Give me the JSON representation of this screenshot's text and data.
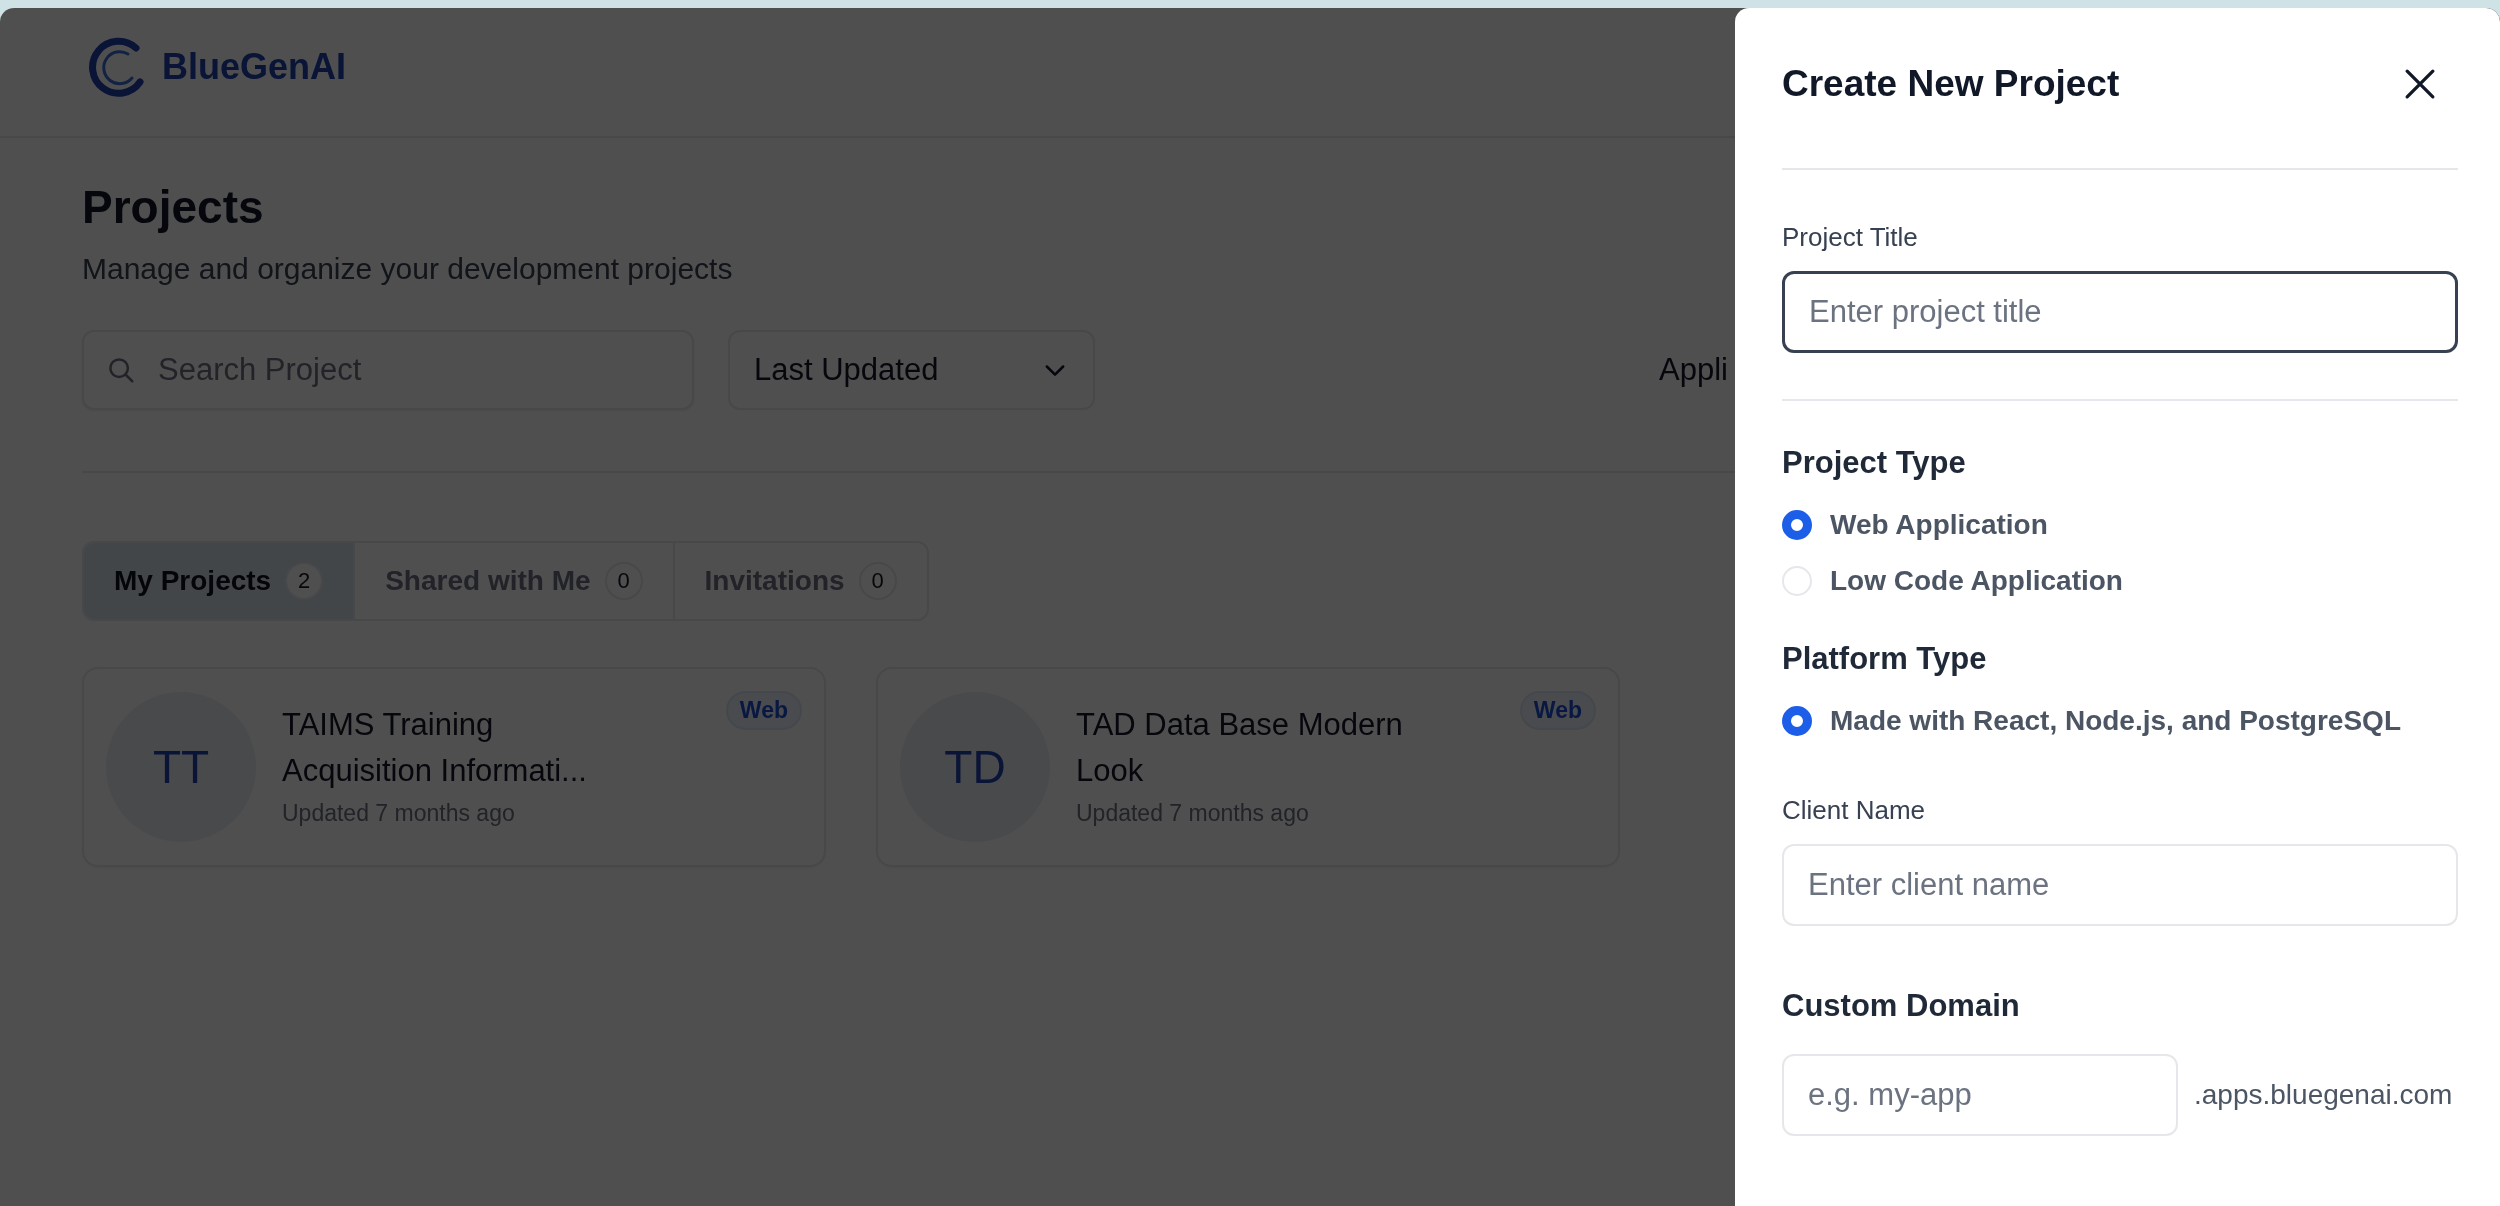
{
  "app": {
    "logo_text": "BlueGenAI"
  },
  "page": {
    "title": "Projects",
    "subtitle": "Manage and organize your development projects",
    "search": {
      "placeholder": "Search Project"
    },
    "sort": {
      "value": "Last Updated"
    },
    "cut_button": {
      "label": "Appli"
    }
  },
  "tabs": [
    {
      "label": "My Projects",
      "count": "2",
      "selected": true
    },
    {
      "label": "Shared with Me",
      "count": "0",
      "selected": false
    },
    {
      "label": "Invitations",
      "count": "0",
      "selected": false
    }
  ],
  "projects": [
    {
      "initials": "TT",
      "title": "TAIMS Training Acquisition Informati...",
      "updated": "Updated 7 months ago",
      "badge": "Web"
    },
    {
      "initials": "TD",
      "title": "TAD Data Base Modern Look",
      "updated": "Updated 7 months ago",
      "badge": "Web"
    }
  ],
  "dialog": {
    "title": "Create New Project",
    "fields": [
      {
        "kind": "text",
        "label": "Project Title",
        "placeholder": "Enter project title",
        "focused": true,
        "divider_after": true
      },
      {
        "kind": "radio_group",
        "heading": "Project Type",
        "options": [
          {
            "label": "Web Application",
            "selected": true
          },
          {
            "label": "Low Code Application",
            "selected": false
          }
        ]
      },
      {
        "kind": "radio_group",
        "heading": "Platform Type",
        "options": [
          {
            "label": "Made with React, Node.js, and PostgreSQL",
            "selected": true
          }
        ]
      },
      {
        "kind": "text",
        "label": "Client Name",
        "placeholder": "Enter client name",
        "focused": false,
        "divider_after": false
      },
      {
        "kind": "domain",
        "heading": "Custom Domain",
        "placeholder": "e.g. my-app",
        "suffix": ".apps.bluegenai.com"
      }
    ]
  }
}
